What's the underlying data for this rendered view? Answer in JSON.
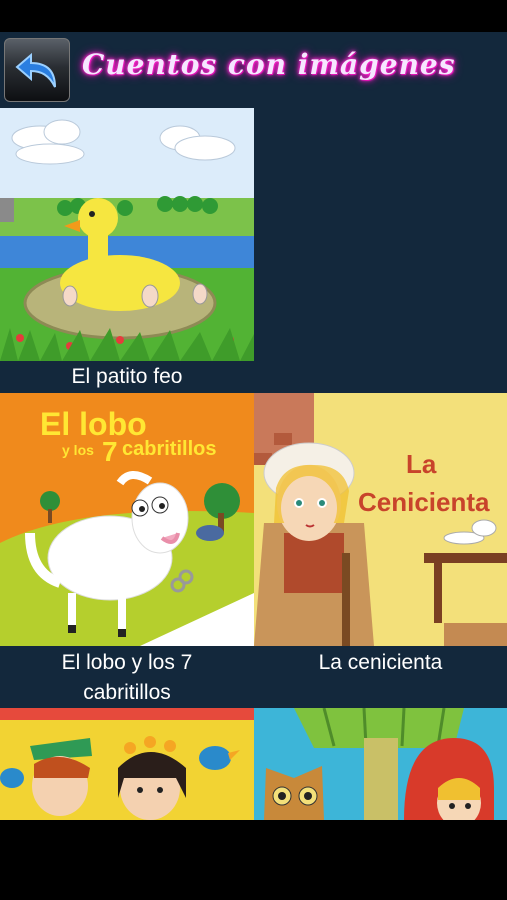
{
  "header": {
    "back_icon": "back-arrow-icon",
    "title": "Cuentos con imágenes"
  },
  "stories": [
    {
      "id": "patito",
      "caption": "El patito feo"
    },
    {
      "id": "lobo",
      "caption": "El lobo y los 7 cabritillos",
      "cover_title_line1": "El lobo",
      "cover_title_line2a": "y los",
      "cover_title_line2b": "7",
      "cover_title_line2c": "cabritillos"
    },
    {
      "id": "cenicienta",
      "caption": "La cenicienta",
      "cover_title_line1": "La",
      "cover_title_line2": "Cenicienta"
    },
    {
      "id": "story4",
      "caption": ""
    },
    {
      "id": "story5",
      "caption": ""
    }
  ],
  "colors": {
    "background": "#13283c",
    "title_glow": "#ff2ad0",
    "lobo_bg": "#f08a1c",
    "cenicienta_title": "#c8442b"
  }
}
